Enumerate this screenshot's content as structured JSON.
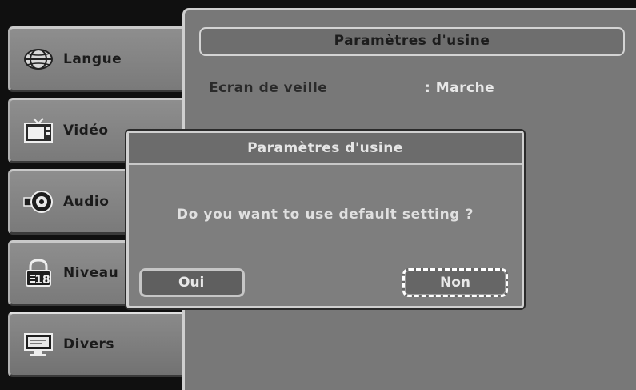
{
  "sidebar": {
    "items": [
      {
        "label": "Langue",
        "icon": "globe-icon"
      },
      {
        "label": "Vidéo",
        "icon": "tv-icon"
      },
      {
        "label": "Audio",
        "icon": "speaker-icon"
      },
      {
        "label": "Niveau",
        "icon": "padlock-icon"
      },
      {
        "label": "Divers",
        "icon": "monitor-icon"
      }
    ],
    "active_index": 4
  },
  "panel": {
    "title": "Paramètres d'usine",
    "settings": [
      {
        "name": "Ecran de veille",
        "value": ": Marche"
      }
    ]
  },
  "dialog": {
    "title": "Paramètres d'usine",
    "message": "Do you want to use default setting ?",
    "yes_label": "Oui",
    "no_label": "Non",
    "focused": "Non"
  },
  "colors": {
    "panel_bg": "#787878",
    "border_light": "#d0d0d0",
    "text_dark": "#1b1b1b",
    "text_light": "#e8e8e8"
  }
}
